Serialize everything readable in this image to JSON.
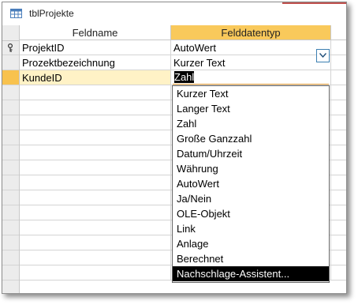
{
  "window": {
    "title": "tblProjekte"
  },
  "columns": {
    "field_name": "Feldname",
    "data_type": "Felddatentyp"
  },
  "rows": [
    {
      "field_name": "ProjektID",
      "data_type": "AutoWert",
      "is_key": true
    },
    {
      "field_name": "Prozektbezeichnung",
      "data_type": "Kurzer Text"
    },
    {
      "field_name": "KundeID",
      "data_type": "Zahl",
      "current": true
    }
  ],
  "editor": {
    "value": "Zahl"
  },
  "dropdown": {
    "options": [
      "Kurzer Text",
      "Langer Text",
      "Zahl",
      "Große Ganzzahl",
      "Datum/Uhrzeit",
      "Währung",
      "AutoWert",
      "Ja/Nein",
      "OLE-Objekt",
      "Link",
      "Anlage",
      "Berechnet",
      "Nachschlage-Assistent..."
    ],
    "highlighted_index": 12
  },
  "colors": {
    "accent_header": "#f9c95b",
    "current_row_marker": "#f8c24e",
    "highlight": "#000000"
  },
  "icons": {
    "table": "table-icon",
    "key": "primary-key-icon",
    "dropdown": "chevron-down-icon"
  }
}
